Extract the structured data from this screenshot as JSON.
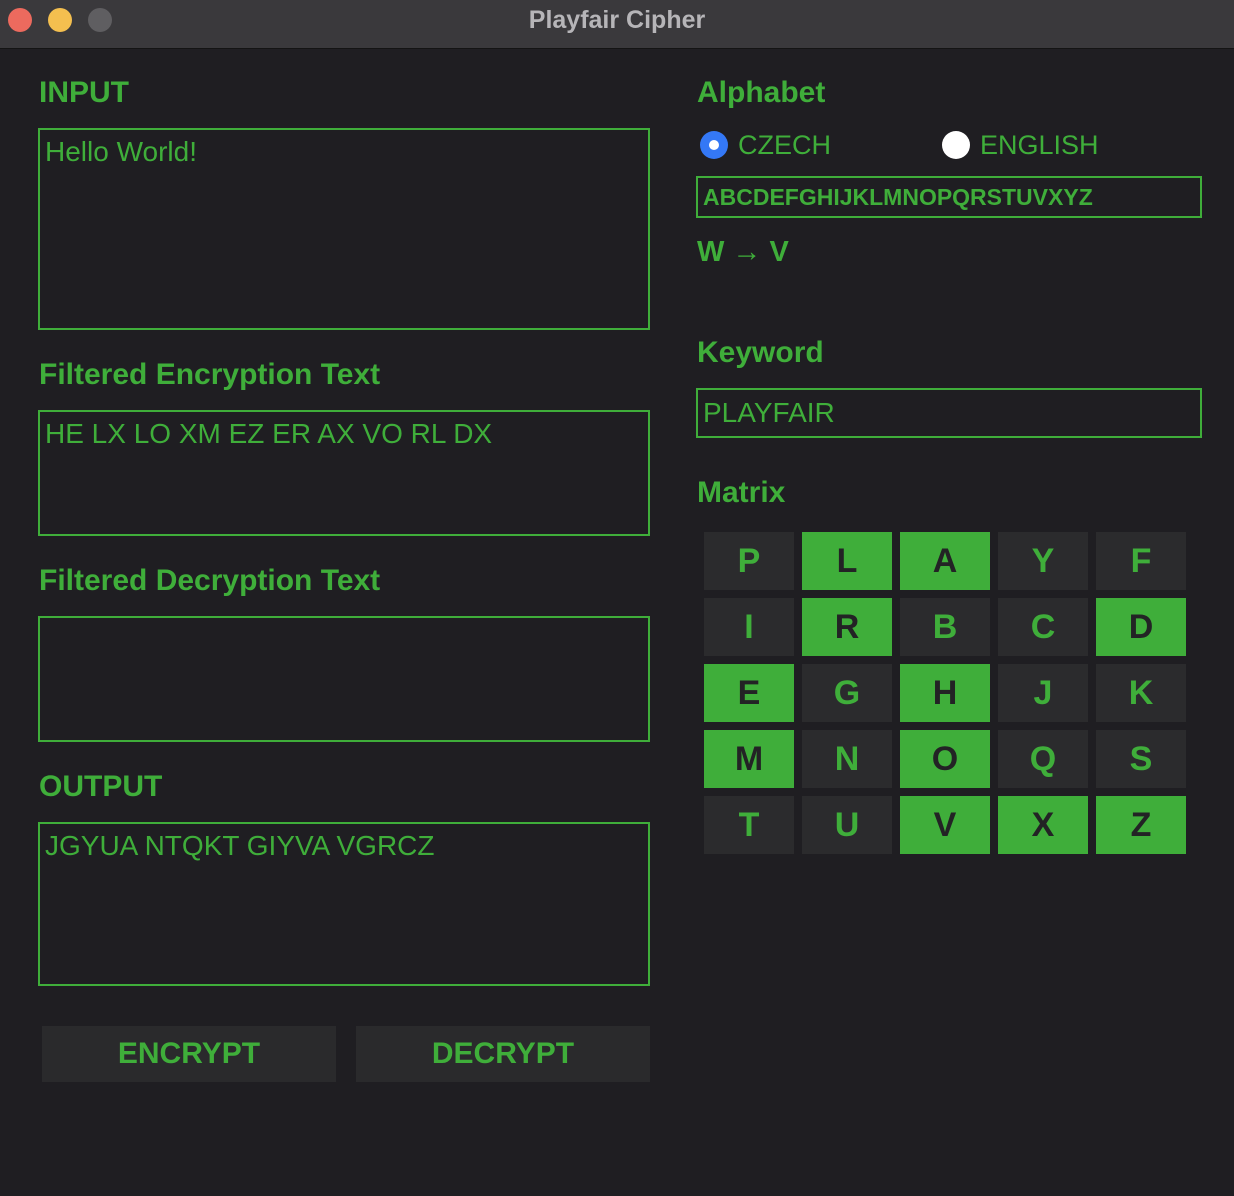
{
  "window": {
    "title": "Playfair Cipher"
  },
  "colors": {
    "accent": "#3fae3a",
    "background": "#1f1e22",
    "cell_bg": "#2b2b2d",
    "radio_selected": "#3478f6"
  },
  "input": {
    "label": "INPUT",
    "value": "Hello World!"
  },
  "filtered_encryption": {
    "label": "Filtered Encryption Text",
    "value": "HE LX LO XM EZ ER AX VO RL DX"
  },
  "filtered_decryption": {
    "label": "Filtered Decryption Text",
    "value": ""
  },
  "output": {
    "label": "OUTPUT",
    "value": "JGYUA NTQKT GIYVA VGRCZ"
  },
  "buttons": {
    "encrypt": "ENCRYPT",
    "decrypt": "DECRYPT"
  },
  "alphabet": {
    "label": "Alphabet",
    "options": [
      {
        "label": "CZECH",
        "selected": true
      },
      {
        "label": "ENGLISH",
        "selected": false
      }
    ],
    "value": "ABCDEFGHIJKLMNOPQRSTUVXYZ",
    "replacement": "W → V"
  },
  "keyword": {
    "label": "Keyword",
    "value": "PLAYFAIR"
  },
  "matrix": {
    "label": "Matrix",
    "cells": [
      {
        "letter": "P",
        "highlighted": false
      },
      {
        "letter": "L",
        "highlighted": true
      },
      {
        "letter": "A",
        "highlighted": true
      },
      {
        "letter": "Y",
        "highlighted": false
      },
      {
        "letter": "F",
        "highlighted": false
      },
      {
        "letter": "I",
        "highlighted": false
      },
      {
        "letter": "R",
        "highlighted": true
      },
      {
        "letter": "B",
        "highlighted": false
      },
      {
        "letter": "C",
        "highlighted": false
      },
      {
        "letter": "D",
        "highlighted": true
      },
      {
        "letter": "E",
        "highlighted": true
      },
      {
        "letter": "G",
        "highlighted": false
      },
      {
        "letter": "H",
        "highlighted": true
      },
      {
        "letter": "J",
        "highlighted": false
      },
      {
        "letter": "K",
        "highlighted": false
      },
      {
        "letter": "M",
        "highlighted": true
      },
      {
        "letter": "N",
        "highlighted": false
      },
      {
        "letter": "O",
        "highlighted": true
      },
      {
        "letter": "Q",
        "highlighted": false
      },
      {
        "letter": "S",
        "highlighted": false
      },
      {
        "letter": "T",
        "highlighted": false
      },
      {
        "letter": "U",
        "highlighted": false
      },
      {
        "letter": "V",
        "highlighted": true
      },
      {
        "letter": "X",
        "highlighted": true
      },
      {
        "letter": "Z",
        "highlighted": true
      }
    ]
  }
}
